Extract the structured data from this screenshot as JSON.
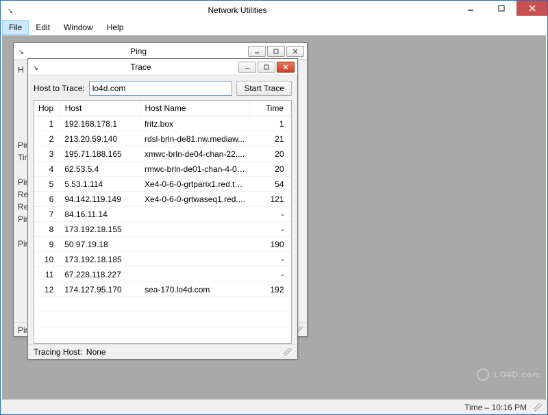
{
  "app": {
    "title": "Network Utilities"
  },
  "menubar": {
    "file": "File",
    "edit": "Edit",
    "window": "Window",
    "help": "Help"
  },
  "statusbar": {
    "time_label": "Time – 10:16 PM"
  },
  "ping_window": {
    "title": "Ping",
    "lines": {
      "l0": "H",
      "l1": "",
      "l2": "",
      "l3": "",
      "l4": "Pin",
      "l5": "Tim",
      "l6": "",
      "l7": "Pin",
      "l8": "Re",
      "l9": "Re",
      "l10": "Pin",
      "l11": "",
      "l12": "Pin"
    },
    "status_label": "Pin"
  },
  "trace_window": {
    "title": "Trace",
    "host_label": "Host to Trace:",
    "host_value": "lo4d.com",
    "start_button": "Start Trace",
    "columns": {
      "hop": "Hop",
      "host": "Host",
      "hostname": "Host Name",
      "time": "Time"
    },
    "rows": [
      {
        "hop": "1",
        "host": "192.168.178.1",
        "hostname": "fritz.box",
        "time": "1"
      },
      {
        "hop": "2",
        "host": "213.20.59.140",
        "hostname": "rdsl-brln-de81.nw.mediaw...",
        "time": "21"
      },
      {
        "hop": "3",
        "host": "195.71.188.165",
        "hostname": "xmwc-brln-de04-chan-22....",
        "time": "20"
      },
      {
        "hop": "4",
        "host": "62.53.5.4",
        "hostname": "rmwc-brln-de01-chan-4-0....",
        "time": "20"
      },
      {
        "hop": "5",
        "host": "5.53.1.114",
        "hostname": "Xe4-0-6-0-grtparix1.red.te...",
        "time": "54"
      },
      {
        "hop": "6",
        "host": "94.142.119.149",
        "hostname": "Xe4-0-6-0-grtwaseq1.red....",
        "time": "121"
      },
      {
        "hop": "7",
        "host": "84.16.11.14",
        "hostname": "",
        "time": "-"
      },
      {
        "hop": "8",
        "host": "173.192.18.155",
        "hostname": "",
        "time": "-"
      },
      {
        "hop": "9",
        "host": "50.97.19.18",
        "hostname": "",
        "time": "190"
      },
      {
        "hop": "10",
        "host": "173.192.18.185",
        "hostname": "",
        "time": "-"
      },
      {
        "hop": "11",
        "host": "67.228.118.227",
        "hostname": "",
        "time": "-"
      },
      {
        "hop": "12",
        "host": "174.127.95.170",
        "hostname": "sea-170.lo4d.com",
        "time": "192"
      }
    ],
    "status_label": "Tracing Host:",
    "status_value": "None"
  },
  "watermark": {
    "text": "LO4D.com"
  }
}
